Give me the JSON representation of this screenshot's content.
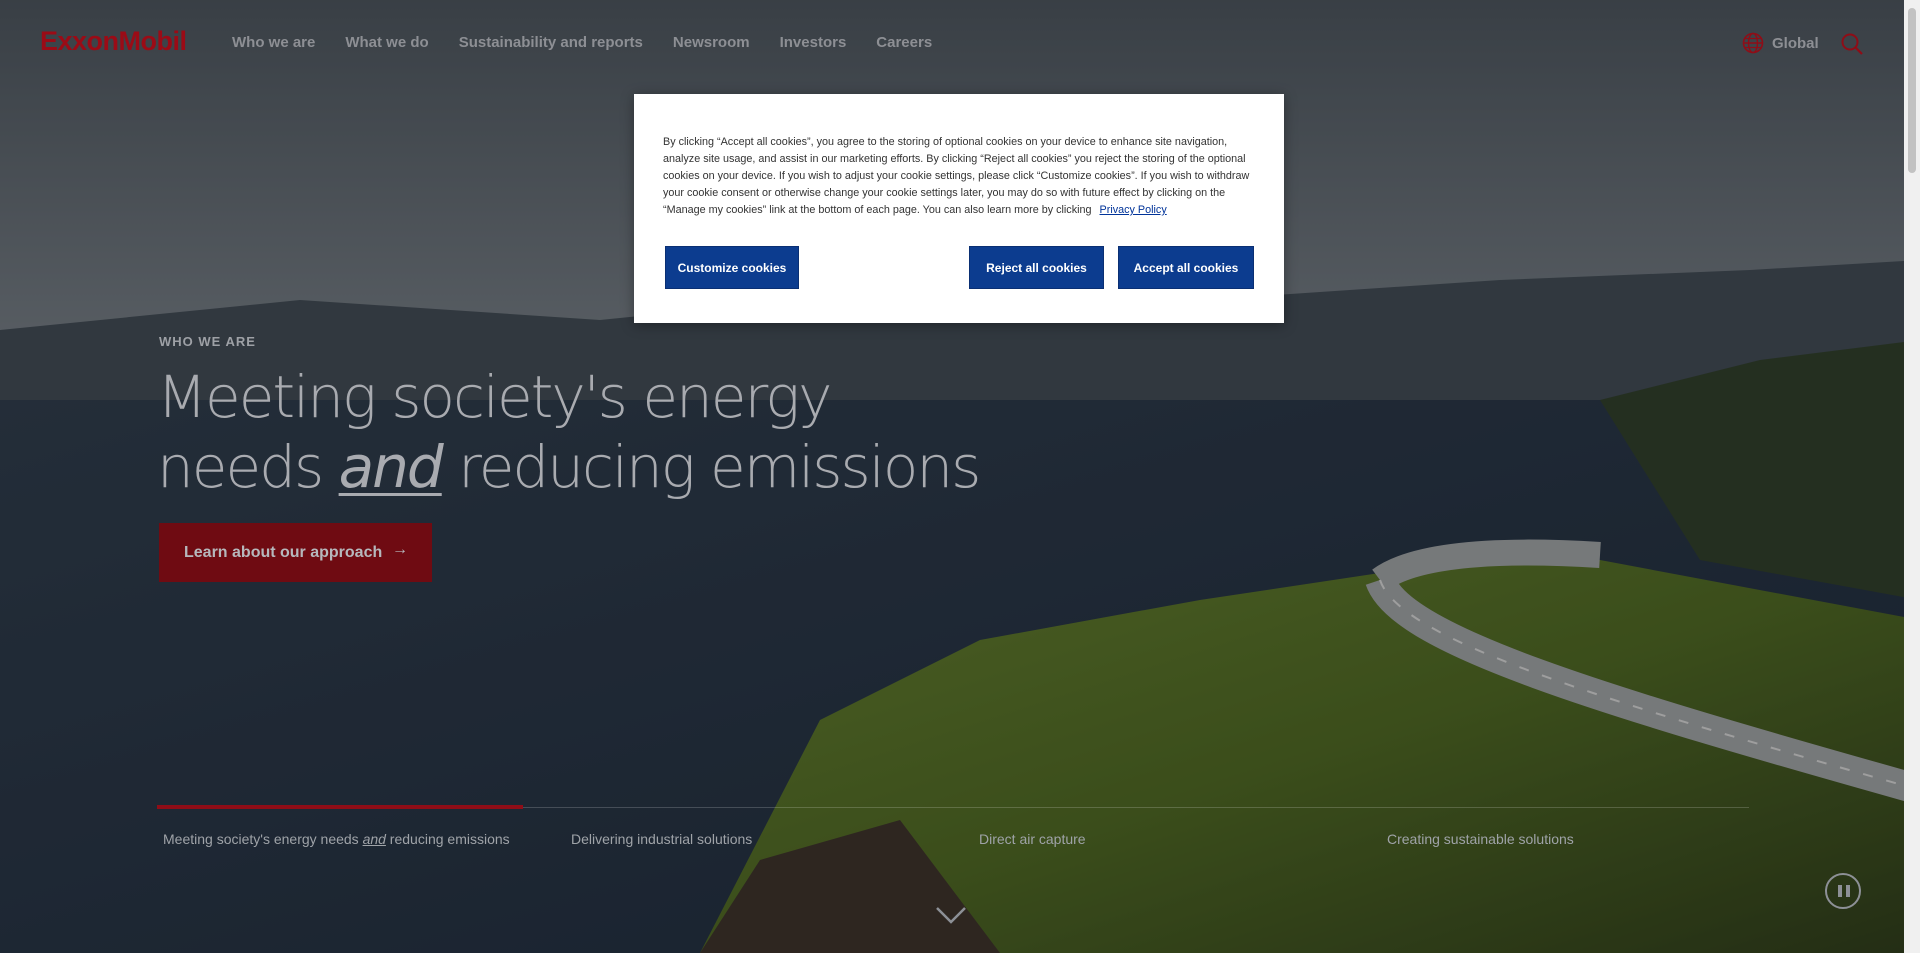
{
  "header": {
    "logo_text": "ExxonMobil",
    "nav": [
      "Who we are",
      "What we do",
      "Sustainability and reports",
      "Newsroom",
      "Investors",
      "Careers"
    ],
    "region_label": "Global",
    "icons": {
      "region": "globe-icon",
      "search": "search-icon"
    }
  },
  "hero": {
    "eyebrow": "WHO WE ARE",
    "headline_line1": "Meeting society's energy",
    "headline_line2_pre": "needs ",
    "headline_line2_em": "and",
    "headline_line2_post": " reducing emissions",
    "cta_label": "Learn about our approach",
    "cta_arrow": "→"
  },
  "carousel": {
    "tabs": [
      {
        "pre": "Meeting society's energy needs ",
        "em": "and",
        "post": " reducing emissions"
      },
      {
        "label": "Delivering industrial solutions"
      },
      {
        "label": "Direct air capture"
      },
      {
        "label": "Creating sustainable solutions"
      }
    ],
    "active_index": 0
  },
  "cookie_banner": {
    "text": "By clicking “Accept all cookies”, you agree to the storing of optional cookies on your device to enhance site navigation, analyze site usage, and assist in our marketing efforts. By clicking “Reject all cookies” you reject the storing of the optional cookies on your device. If you wish to adjust your cookie settings, please click “Customize cookies”. If you wish to withdraw your cookie consent or otherwise change your cookie settings later, you may do so with future effect by clicking on the “Manage my cookies” link at the bottom of each page. You can also learn more by clicking",
    "privacy_link": "Privacy Policy",
    "customize_label": "Customize cookies",
    "reject_label": "Reject all cookies",
    "accept_label": "Accept all cookies"
  },
  "colors": {
    "brand_red": "#9b0b16",
    "cookie_button_blue": "#0c3c8f"
  }
}
